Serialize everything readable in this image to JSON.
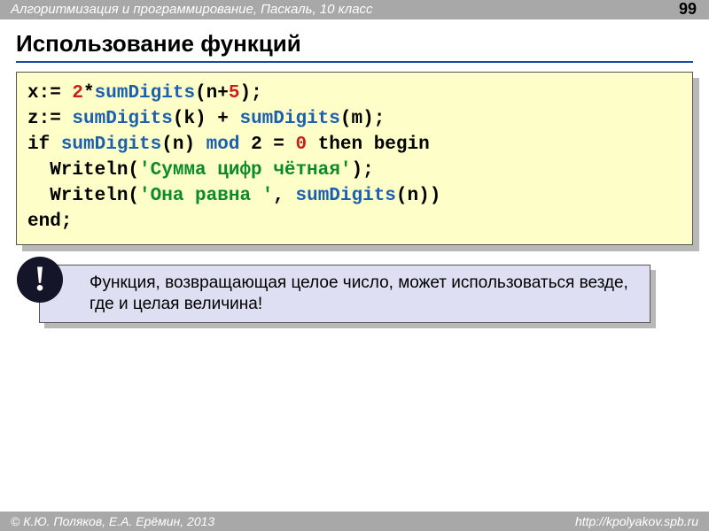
{
  "header": {
    "course": "Алгоритмизация и программирование, Паскаль, 10 класс",
    "page": "99"
  },
  "title": "Использование функций",
  "code": {
    "l1": {
      "a": "x:= ",
      "b": "2",
      "c": "*",
      "d": "sumDigits",
      "e": "(n+",
      "f": "5",
      "g": ");"
    },
    "l2": {
      "a": "z:= ",
      "b": "sumDigits",
      "c": "(k) + ",
      "d": "sumDigits",
      "e": "(m);"
    },
    "l3": {
      "a": "if ",
      "b": "sumDigits",
      "c": "(n) ",
      "d": "mod",
      "e": " 2 = ",
      "f": "0",
      "g": " then begin"
    },
    "l4": {
      "a": "  Writeln(",
      "b": "'Сумма цифр чётная'",
      "c": ");"
    },
    "l5": {
      "a": "  Writeln(",
      "b": "'Она равна '",
      "c": ", ",
      "d": "sumDigits",
      "e": "(n))"
    },
    "l6": {
      "a": "end;"
    }
  },
  "note": {
    "badge": "!",
    "text": "Функция, возвращающая целое число, может использоваться везде, где и целая величина!"
  },
  "footer": {
    "authors": "© К.Ю. Поляков, Е.А. Ерёмин, 2013",
    "url": "http://kpolyakov.spb.ru"
  }
}
